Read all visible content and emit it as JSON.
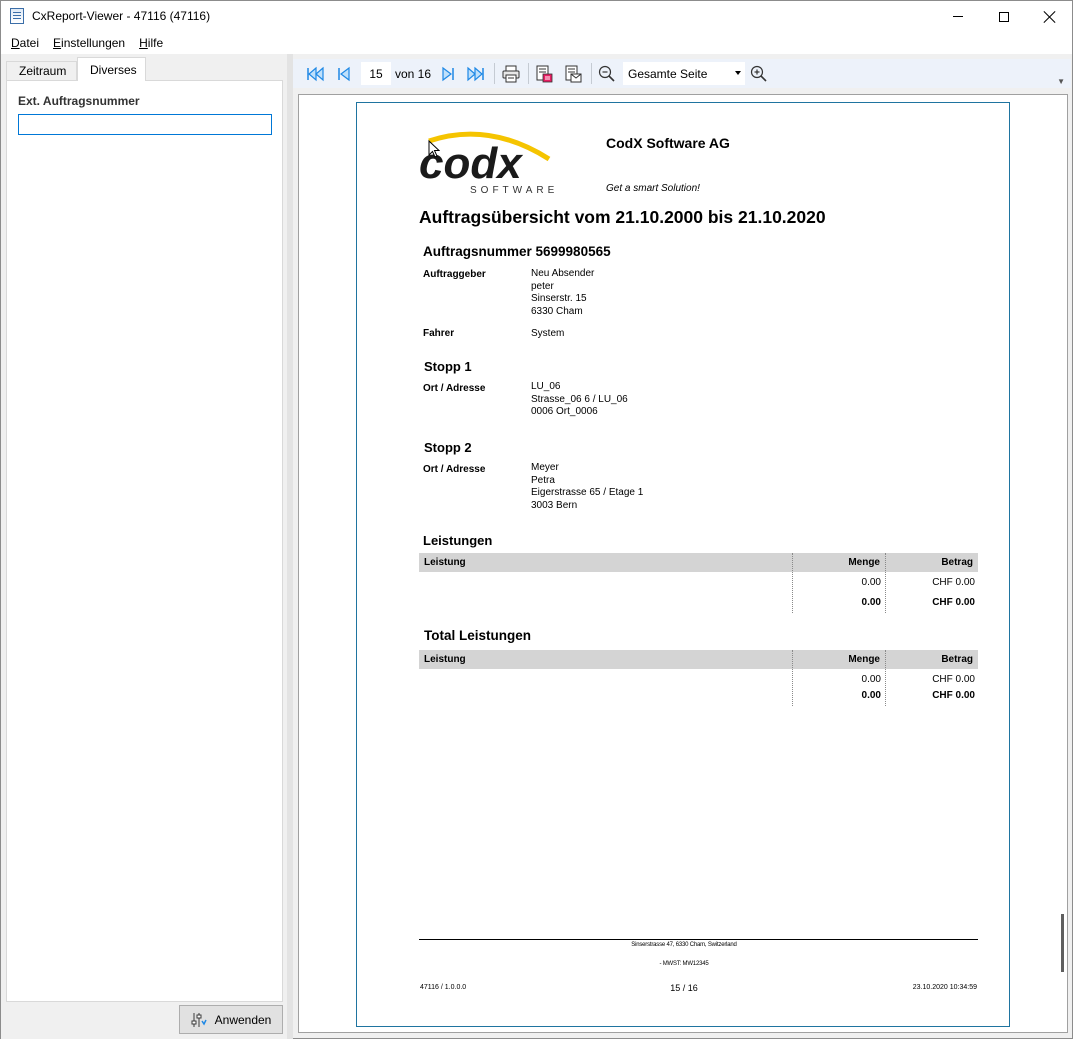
{
  "window": {
    "title": "CxReport-Viewer - 47116 (47116)"
  },
  "menu": {
    "items": [
      {
        "label_prefix": "",
        "accel": "D",
        "label_rest": "atei"
      },
      {
        "label_prefix": "",
        "accel": "E",
        "label_rest": "instellungen"
      },
      {
        "label_prefix": "",
        "accel": "H",
        "label_rest": "ilfe"
      }
    ]
  },
  "left_panel": {
    "tabs": [
      {
        "label": "Zeitraum",
        "active": false
      },
      {
        "label": "Diverses",
        "active": true
      }
    ],
    "field_label": "Ext. Auftragsnummer",
    "field_value": "",
    "apply_label": "Anwenden"
  },
  "toolbar": {
    "current_page": "15",
    "of_label": "von 16",
    "zoom": "Gesamte Seite"
  },
  "colors": {
    "accent": "#0078d7",
    "toolbar_icon": "#1e88e5",
    "page_border": "#1f74a0",
    "table_header": "#d4d4d4",
    "logo_yellow": "#f5c400"
  },
  "report": {
    "logo_text": "codx",
    "logo_sub": "SOFTWARE",
    "company": "CodX Software AG",
    "slogan": "Get a smart Solution!",
    "title": "Auftragsübersicht vom 21.10.2000 bis 21.10.2020",
    "order_heading": "Auftragsnummer 5699980565",
    "client_label": "Auftraggeber",
    "client_lines": [
      "Neu Absender",
      "peter",
      "Sinserstr. 15",
      "6330 Cham"
    ],
    "driver_label": "Fahrer",
    "driver_value": "System",
    "stops": [
      {
        "heading": "Stopp 1",
        "label": "Ort / Adresse",
        "lines": [
          "LU_06",
          "Strasse_06 6 / LU_06",
          "0006 Ort_0006"
        ]
      },
      {
        "heading": "Stopp 2",
        "label": "Ort / Adresse",
        "lines": [
          "Meyer",
          "Petra",
          "Eigerstrasse 65 / Etage 1",
          "3003 Bern"
        ]
      }
    ],
    "services": {
      "heading": "Leistungen",
      "columns": [
        "Leistung",
        "Menge",
        "Betrag"
      ],
      "row": {
        "menge": "0.00",
        "betrag": "CHF 0.00"
      },
      "total": {
        "menge": "0.00",
        "betrag": "CHF 0.00"
      }
    },
    "total_services": {
      "heading": "Total Leistungen",
      "columns": [
        "Leistung",
        "Menge",
        "Betrag"
      ],
      "row": {
        "menge": "0.00",
        "betrag": "CHF 0.00"
      },
      "total": {
        "menge": "0.00",
        "betrag": "CHF 0.00"
      }
    },
    "footer": {
      "address": "Sinserstrasse 47, 6330 Cham, Switzerland",
      "vat": "- MWST: MW12345",
      "version": "47116 / 1.0.0.0",
      "page": "15 / 16",
      "timestamp": "23.10.2020 10:34:59"
    }
  }
}
